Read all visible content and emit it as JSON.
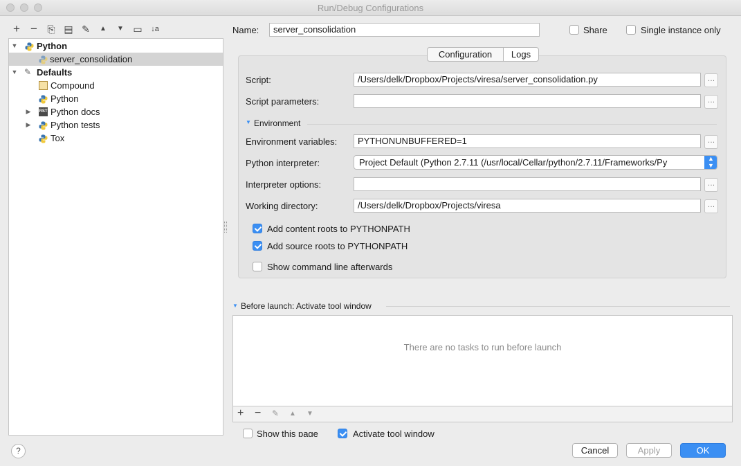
{
  "window": {
    "title": "Run/Debug Configurations"
  },
  "toolbar": {
    "add": "+",
    "remove": "−",
    "copy": "⎘",
    "save": "▤",
    "edit_defaults": "✎",
    "move_up": "▲",
    "move_down": "▼",
    "folder": "▭",
    "sort": "↓a"
  },
  "tree": {
    "python": "Python",
    "server": "server_consolidation",
    "defaults": "Defaults",
    "compound": "Compound",
    "python_default": "Python",
    "python_docs": "Python docs",
    "python_tests": "Python tests",
    "tox": "Tox"
  },
  "header": {
    "name_label": "Name:",
    "name_value": "server_consolidation",
    "share_label": "Share",
    "single_instance_label": "Single instance only"
  },
  "tabs": {
    "configuration": "Configuration",
    "logs": "Logs"
  },
  "form": {
    "script_label": "Script:",
    "script_value": "/Users/delk/Dropbox/Projects/viresa/server_consolidation.py",
    "params_label": "Script parameters:",
    "params_value": "",
    "environment_header": "Environment",
    "env_vars_label": "Environment variables:",
    "env_vars_value": "PYTHONUNBUFFERED=1",
    "interpreter_label": "Python interpreter:",
    "interpreter_value": "Project Default (Python 2.7.11 (/usr/local/Cellar/python/2.7.11/Frameworks/Py",
    "interp_options_label": "Interpreter options:",
    "interp_options_value": "",
    "workdir_label": "Working directory:",
    "workdir_value": "/Users/delk/Dropbox/Projects/viresa",
    "content_roots_label": "Add content roots to PYTHONPATH",
    "source_roots_label": "Add source roots to PYTHONPATH",
    "show_cmd_label": "Show command line afterwards",
    "browse": "…"
  },
  "before_launch": {
    "header": "Before launch: Activate tool window",
    "empty_text": "There are no tasks to run before launch",
    "add": "+",
    "remove": "−",
    "edit": "✎",
    "up": "▲",
    "down": "▼",
    "show_page_label": "Show this page",
    "activate_label": "Activate tool window"
  },
  "footer": {
    "help": "?",
    "cancel": "Cancel",
    "apply": "Apply",
    "ok": "OK"
  },
  "colors": {
    "accent": "#3b8ff3",
    "selection": "#d4d4d4"
  }
}
